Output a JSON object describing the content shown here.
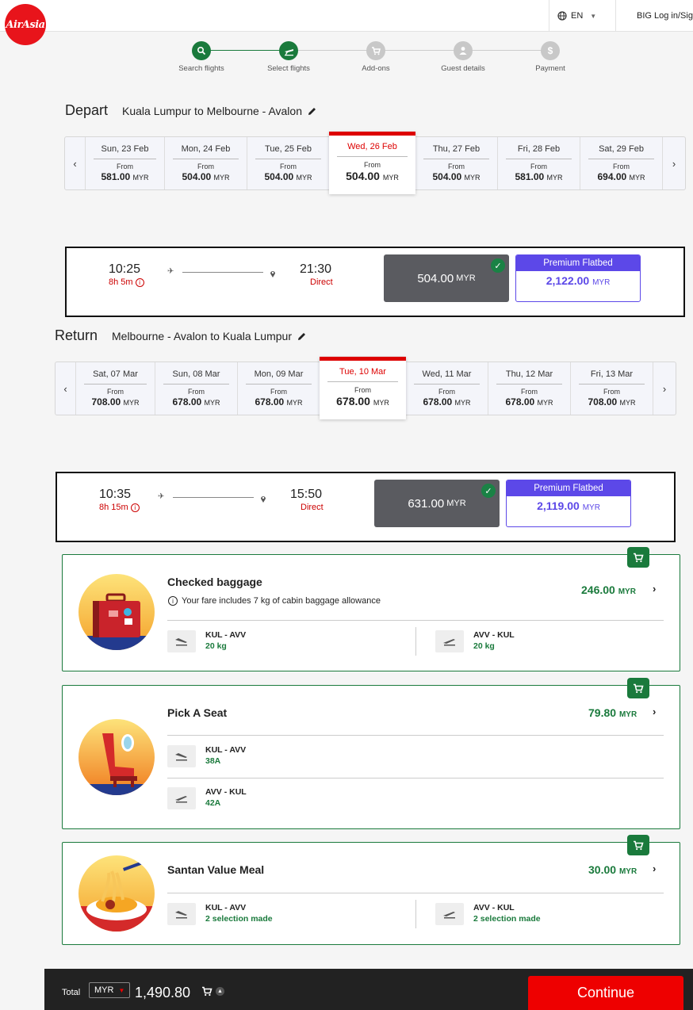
{
  "header": {
    "logo": "AirAsia",
    "lang": "EN",
    "login": "BIG Log in/Sign up"
  },
  "steps": [
    {
      "label": "Search flights",
      "icon": "search-icon",
      "active": true
    },
    {
      "label": "Select flights",
      "icon": "plane-icon",
      "active": true
    },
    {
      "label": "Add-ons",
      "icon": "cart-icon",
      "active": false
    },
    {
      "label": "Guest details",
      "icon": "person-icon",
      "active": false
    },
    {
      "label": "Payment",
      "icon": "dollar-icon",
      "active": false
    }
  ],
  "depart": {
    "title": "Depart",
    "route": "Kuala Lumpur to Melbourne - Avalon",
    "dates": [
      {
        "date": "Sun, 23 Feb",
        "from": "From",
        "price": "581.00",
        "cur": "MYR"
      },
      {
        "date": "Mon, 24 Feb",
        "from": "From",
        "price": "504.00",
        "cur": "MYR"
      },
      {
        "date": "Tue, 25 Feb",
        "from": "From",
        "price": "504.00",
        "cur": "MYR"
      },
      {
        "date": "Wed, 26 Feb",
        "from": "From",
        "price": "504.00",
        "cur": "MYR"
      },
      {
        "date": "Thu, 27 Feb",
        "from": "From",
        "price": "504.00",
        "cur": "MYR"
      },
      {
        "date": "Fri, 28 Feb",
        "from": "From",
        "price": "581.00",
        "cur": "MYR"
      },
      {
        "date": "Sat, 29 Feb",
        "from": "From",
        "price": "694.00",
        "cur": "MYR"
      }
    ],
    "flight": {
      "dep": "10:25",
      "dur": "8h 5m",
      "arr": "21:30",
      "stops": "Direct",
      "fare": "504.00",
      "fare_cur": "MYR",
      "prem_label": "Premium Flatbed",
      "prem_price": "2,122.00",
      "prem_cur": "MYR"
    }
  },
  "ret": {
    "title": "Return",
    "route": "Melbourne - Avalon to Kuala Lumpur",
    "dates": [
      {
        "date": "Sat, 07 Mar",
        "from": "From",
        "price": "708.00",
        "cur": "MYR"
      },
      {
        "date": "Sun, 08 Mar",
        "from": "From",
        "price": "678.00",
        "cur": "MYR"
      },
      {
        "date": "Mon, 09 Mar",
        "from": "From",
        "price": "678.00",
        "cur": "MYR"
      },
      {
        "date": "Tue, 10 Mar",
        "from": "From",
        "price": "678.00",
        "cur": "MYR"
      },
      {
        "date": "Wed, 11 Mar",
        "from": "From",
        "price": "678.00",
        "cur": "MYR"
      },
      {
        "date": "Thu, 12 Mar",
        "from": "From",
        "price": "678.00",
        "cur": "MYR"
      },
      {
        "date": "Fri, 13 Mar",
        "from": "From",
        "price": "708.00",
        "cur": "MYR"
      }
    ],
    "flight": {
      "dep": "10:35",
      "dur": "8h 15m",
      "arr": "15:50",
      "stops": "Direct",
      "fare": "631.00",
      "fare_cur": "MYR",
      "prem_label": "Premium Flatbed",
      "prem_price": "2,119.00",
      "prem_cur": "MYR"
    }
  },
  "baggage": {
    "title": "Checked baggage",
    "note": "Your fare includes 7 kg of cabin baggage allowance",
    "price": "246.00",
    "cur": "MYR",
    "legs": [
      {
        "route": "KUL - AVV",
        "value": "20 kg"
      },
      {
        "route": "AVV - KUL",
        "value": "20 kg"
      }
    ]
  },
  "seat": {
    "title": "Pick A Seat",
    "price": "79.80",
    "cur": "MYR",
    "legs": [
      {
        "route": "KUL - AVV",
        "value": "38A"
      },
      {
        "route": "AVV - KUL",
        "value": "42A"
      }
    ]
  },
  "meal": {
    "title": "Santan Value Meal",
    "price": "30.00",
    "cur": "MYR",
    "legs": [
      {
        "route": "KUL - AVV",
        "value": "2 selection made"
      },
      {
        "route": "AVV - KUL",
        "value": "2 selection made"
      }
    ]
  },
  "footer": {
    "total_label": "Total",
    "currency": "MYR",
    "total": "1,490.80",
    "continue": "Continue"
  },
  "colors": {
    "brand": "#e8141b",
    "green": "#1a7a3c",
    "premium": "#5c48e8",
    "selected_red": "#dd0000"
  }
}
